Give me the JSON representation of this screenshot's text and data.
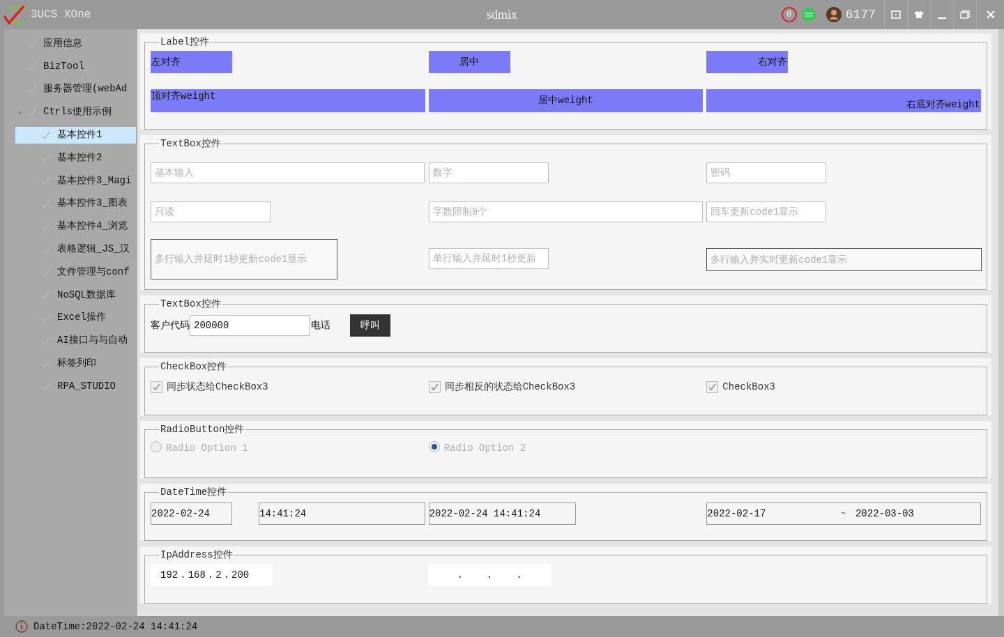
{
  "window": {
    "app_name": "3UCS XOne",
    "title": "sdmix",
    "badge": "0",
    "user_count": "6177"
  },
  "sidebar": {
    "items": [
      {
        "label": "应用信息",
        "selected": false
      },
      {
        "label": "BizTool",
        "selected": false
      },
      {
        "label": "服务器管理(webAd",
        "selected": false
      },
      {
        "label": "Ctrls使用示例",
        "selected": false,
        "expanded": true,
        "children": [
          {
            "label": "基本控件1",
            "selected": true
          },
          {
            "label": "基本控件2",
            "selected": false
          },
          {
            "label": "基本控件3_Magi",
            "selected": false
          },
          {
            "label": "基本控件3_图表",
            "selected": false
          },
          {
            "label": "基本控件4_浏览",
            "selected": false
          },
          {
            "label": "表格逻辑_JS_汉",
            "selected": false
          },
          {
            "label": "文件管理与conf",
            "selected": false
          },
          {
            "label": "NoSQL数据库",
            "selected": false
          },
          {
            "label": "Excel操作",
            "selected": false
          },
          {
            "label": "AI接口与与自动",
            "selected": false
          },
          {
            "label": "标签列印",
            "selected": false
          },
          {
            "label": "RPA_STUDIO",
            "selected": false
          }
        ]
      }
    ]
  },
  "label_group": {
    "title": "Label控件",
    "labels": [
      {
        "text": "左对齐",
        "kind": "left"
      },
      {
        "text": "居中",
        "kind": "center"
      },
      {
        "text": "右对齐",
        "kind": "right"
      },
      {
        "text": "顶对齐weight",
        "kind": "topleft"
      },
      {
        "text": "居中weight",
        "kind": "center"
      },
      {
        "text": "右底对齐weight",
        "kind": "bottomright"
      }
    ]
  },
  "textbox_group": {
    "title": "TextBox控件",
    "fields": [
      {
        "placeholder": "基本输入",
        "kind": "input"
      },
      {
        "placeholder": "数字",
        "kind": "input"
      },
      {
        "placeholder": "密码",
        "kind": "input"
      },
      {
        "placeholder": "只读",
        "kind": "input"
      },
      {
        "placeholder": "字数限制9个",
        "kind": "input"
      },
      {
        "placeholder": "回车更新code1显示",
        "kind": "input"
      },
      {
        "placeholder": "多行输入并延时1秒更新code1显示",
        "kind": "multiline"
      },
      {
        "placeholder": "单行输入并延时1秒更新",
        "kind": "input"
      },
      {
        "placeholder": "多行输入并实时更新code1显示",
        "kind": "multiline"
      }
    ]
  },
  "customer_group": {
    "title": "TextBox控件",
    "code_label": "客户代码",
    "code_value": "200000",
    "phone_label": "电话",
    "call_button": "呼叫"
  },
  "checkbox_group": {
    "title": "CheckBox控件",
    "checkboxes": [
      {
        "label": "同步状态给CheckBox3",
        "checked": true
      },
      {
        "label": "同步相反的状态给CheckBox3",
        "checked": true
      },
      {
        "label": "CheckBox3",
        "checked": true
      }
    ]
  },
  "radio_group": {
    "title": "RadioButton控件",
    "radios": [
      {
        "label": "Radio Option 1",
        "selected": false,
        "disabled": true
      },
      {
        "label": "Radio Option 2",
        "selected": true,
        "disabled": true
      }
    ]
  },
  "datetime_group": {
    "title": "DateTime控件",
    "date": "2022-02-24",
    "time": "14:41:24",
    "datetime": "2022-02-24 14:41:24",
    "range": {
      "start": "2022-02-17",
      "separator": "~",
      "end": "2022-03-03"
    }
  },
  "ip_group": {
    "title": "IpAddress控件",
    "addresses": [
      {
        "kind": "filled",
        "parts": [
          "192",
          ".",
          "168",
          ".",
          "2",
          ".",
          "200"
        ]
      },
      {
        "kind": "empty",
        "parts": [
          ".",
          ".",
          "."
        ]
      }
    ]
  },
  "status_bar": {
    "text": "DateTime:2022-02-24 14:41:24"
  }
}
